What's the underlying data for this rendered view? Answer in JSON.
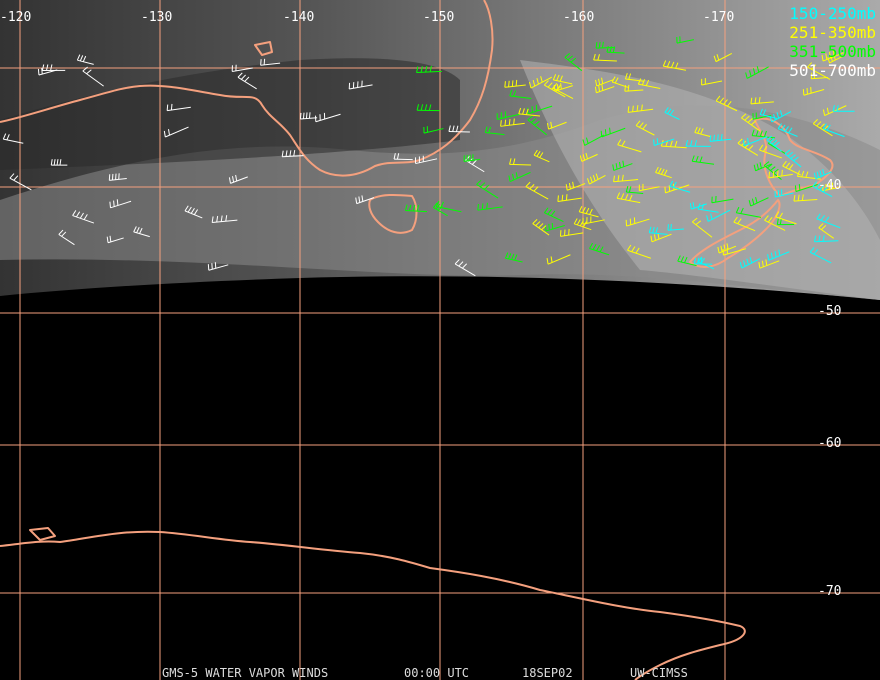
{
  "lon_labels": [
    "-120",
    "-130",
    "-140",
    "-150",
    "-160",
    "-170"
  ],
  "lat_labels": [
    "-40",
    "-50",
    "-60",
    "-70"
  ],
  "legend": [
    {
      "label": "150-250mb",
      "color": "#00ffff"
    },
    {
      "label": "251-350mb",
      "color": "#ffff00"
    },
    {
      "label": "351-500mb",
      "color": "#00ff00"
    },
    {
      "label": "501-700mb",
      "color": "#ffffff"
    }
  ],
  "footer": {
    "product": "GMS-5 WATER VAPOR WINDS",
    "time": "00:00 UTC",
    "date": "18SEP02",
    "source": "UW-CIMSS"
  },
  "colors": {
    "grid": "#f4a07e",
    "coast": "#f4a07e"
  }
}
